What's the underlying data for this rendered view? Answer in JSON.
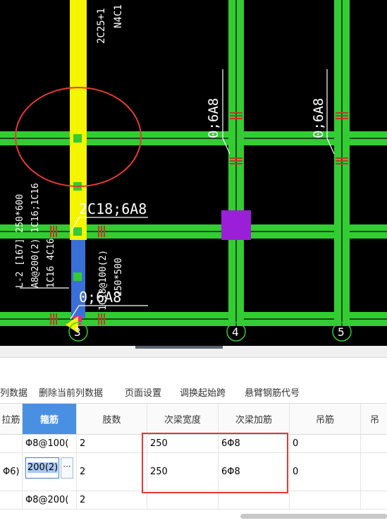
{
  "cad": {
    "texts": {
      "top_beam_1": "2C25+1",
      "top_beam_2": "N4C1",
      "span_note_a": "0;6A8",
      "span_note_b": "0;6A8",
      "beam_main": "2C18;6A8",
      "beam_lower": "0;6A8",
      "vert_1": "L-2 [167] 250*600",
      "vert_2": "A8@200(2) 1C16;1C16",
      "vert_3": "1C16 4C16",
      "vert_4": "1C18@100(2)",
      "vert_5": "250*500",
      "grid_3": "3",
      "grid_4": "4",
      "grid_5": "5"
    },
    "colors": {
      "beam": "#33cc33",
      "highlight_beam": "#f5f500",
      "column": "#9b1fd8",
      "annotation": "#e53935",
      "background": "#000000"
    }
  },
  "toolbar": {
    "items": [
      "列数据",
      "删除当前列数据",
      "页面设置",
      "调换起始跨",
      "悬臂钢筋代号"
    ]
  },
  "grid": {
    "headers": [
      "拉筋",
      "箍筋",
      "肢数",
      "次梁宽度",
      "次梁加筋",
      "吊筋",
      "吊"
    ],
    "selected_header": "箍筋",
    "rows": [
      {
        "c0": "",
        "c1": "Φ8@100(",
        "c2": "2",
        "c3": "250",
        "c4": "6Φ8",
        "c5": "0",
        "c6": ""
      },
      {
        "c0": "Φ6)",
        "c1": "200(2)",
        "c2": "2",
        "c3": "250",
        "c4": "6Φ8",
        "c5": "0",
        "c6": ""
      },
      {
        "c0": "",
        "c1": "Φ8@200(",
        "c2": "2",
        "c3": "",
        "c4": "",
        "c5": "",
        "c6": ""
      }
    ],
    "edit_button": "···"
  }
}
